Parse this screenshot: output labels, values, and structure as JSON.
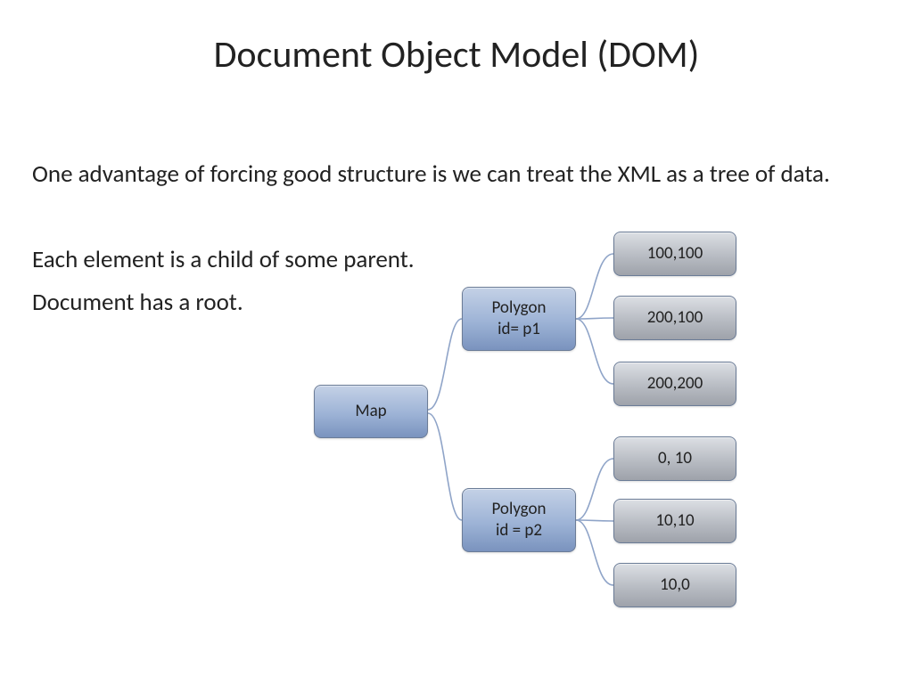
{
  "title": "Document Object Model (DOM)",
  "paragraphs": {
    "p1": "One advantage of forcing good structure is we can treat the XML as a tree of data.",
    "p2": "Each element is a child of some parent.",
    "p3": "Document has a root."
  },
  "tree": {
    "root": {
      "label": "Map"
    },
    "poly1": {
      "line1": "Polygon",
      "line2": "id= p1"
    },
    "poly2": {
      "line1": "Polygon",
      "line2": "id = p2"
    },
    "leaves": {
      "l1": "100,100",
      "l2": "200,100",
      "l3": "200,200",
      "l4": "0, 10",
      "l5": "10,10",
      "l6": "10,0"
    }
  }
}
